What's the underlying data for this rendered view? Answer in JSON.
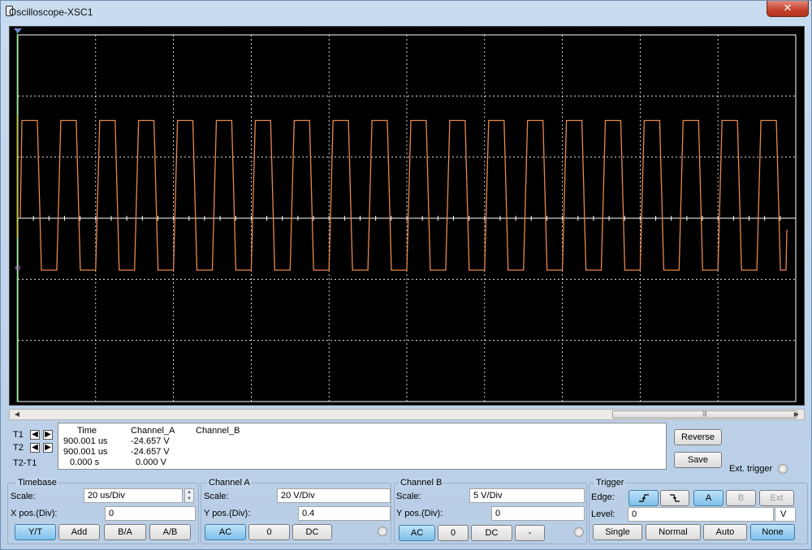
{
  "window": {
    "title": "Oscilloscope-XSC1",
    "close_label": "✕"
  },
  "readout": {
    "headers": {
      "time": "Time",
      "channel_a": "Channel_A",
      "channel_b": "Channel_B"
    },
    "rows": [
      {
        "label": "T1",
        "time": "900.001 us",
        "channel_a": "-24.657 V",
        "channel_b": ""
      },
      {
        "label": "T2",
        "time": "900.001 us",
        "channel_a": "-24.657 V",
        "channel_b": ""
      },
      {
        "label": "T2-T1",
        "time": "0.000 s",
        "channel_a": "0.000 V",
        "channel_b": ""
      }
    ]
  },
  "actions": {
    "reverse": "Reverse",
    "save": "Save",
    "ext_trigger": "Ext. trigger"
  },
  "timebase": {
    "title": "Timebase",
    "scale_label": "Scale:",
    "scale_value": "20 us/Div",
    "xpos_label": "X pos.(Div):",
    "xpos_value": "0",
    "modes": [
      "Y/T",
      "Add",
      "B/A",
      "A/B"
    ],
    "active_mode": "Y/T"
  },
  "channel_a": {
    "title": "Channel A",
    "scale_label": "Scale:",
    "scale_value": "20  V/Div",
    "ypos_label": "Y pos.(Div):",
    "ypos_value": "0.4",
    "coupling": [
      "AC",
      "0",
      "DC"
    ],
    "active_coupling": "AC"
  },
  "channel_b": {
    "title": "Channel B",
    "scale_label": "Scale:",
    "scale_value": "5  V/Div",
    "ypos_label": "Y pos.(Div):",
    "ypos_value": "0",
    "coupling": [
      "AC",
      "0",
      "DC",
      "-"
    ],
    "active_coupling": "AC"
  },
  "trigger": {
    "title": "Trigger",
    "edge_label": "Edge:",
    "edges": [
      "rising-edge-icon",
      "falling-edge-icon"
    ],
    "sources": [
      "A",
      "B",
      "Ext"
    ],
    "active_source": "A",
    "level_label": "Level:",
    "level_value": "0",
    "level_unit": "V",
    "modes": [
      "Single",
      "Normal",
      "Auto",
      "None"
    ],
    "active_mode": "None"
  },
  "colors": {
    "trace_a": "#e8884a",
    "grid": "#ffffff",
    "screen": "#000000",
    "cursor1": "#3fbf3f",
    "cursor2": "#d0c040"
  },
  "chart_data": {
    "type": "line",
    "title": "",
    "xlabel": "",
    "ylabel": "",
    "x_divisions": 10,
    "y_divisions": 6,
    "series": [
      {
        "channel": "A",
        "waveform": "square",
        "high_div": 1.6,
        "low_div": -0.85,
        "cycles_visible": 20,
        "duty": 0.5
      }
    ],
    "grid": true
  }
}
